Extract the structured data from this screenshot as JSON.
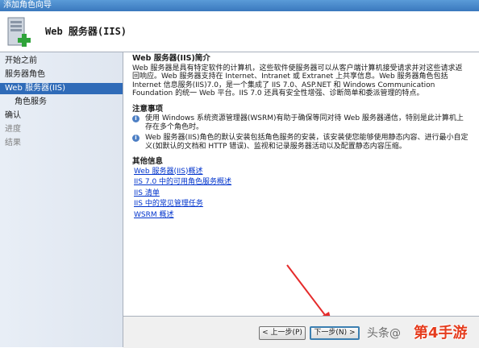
{
  "window": {
    "title": "添加角色向导"
  },
  "header": {
    "title": "Web 服务器(IIS)"
  },
  "nav": {
    "items": [
      {
        "label": "开始之前"
      },
      {
        "label": "服务器角色"
      },
      {
        "label": "Web 服务器(IIS)"
      },
      {
        "label": "角色服务"
      },
      {
        "label": "确认"
      },
      {
        "label": "进度"
      },
      {
        "label": "结果"
      }
    ]
  },
  "content": {
    "intro_title": "Web 服务器(IIS)简介",
    "intro_text": "Web 服务器是具有特定软件的计算机，这些软件使服务器可以从客户端计算机接受请求并对这些请求返回响应。Web 服务器支持在 Internet、Intranet 或 Extranet 上共享信息。Web 服务器角色包括 Internet 信息服务(IIS)7.0，是一个集成了 IIS 7.0、ASP.NET 和 Windows Communication Foundation 的统一 Web 平台。IIS 7.0 还具有安全性增强、诊断简单和委派管理的特点。",
    "notes_title": "注意事项",
    "note1": "使用 Windows 系统资源管理器(WSRM)有助于确保等同对待 Web 服务器通信，特别是此计算机上存在多个角色时。",
    "note2": "Web 服务器(IIS)角色的默认安装包括角色服务的安装，该安装使您能够使用静态内容、进行最小自定义(如默认的文档和 HTTP 错误)、监视和记录服务器活动以及配置静态内容压缩。",
    "more_title": "其他信息",
    "links": [
      {
        "label": "Web 服务器(IIS)概述"
      },
      {
        "label": "IIS 7.0 中的可用角色服务概述"
      },
      {
        "label": "IIS 清单"
      },
      {
        "label": "IIS 中的常见管理任务"
      },
      {
        "label": "WSRM 概述"
      }
    ]
  },
  "footer": {
    "prev_label": "< 上一步(P)",
    "next_label": "下一步(N) >",
    "watermark": "头条@",
    "brand": "第4手游"
  },
  "colors": {
    "accent": "#2f6bb8",
    "link": "#0033cc",
    "arrow": "#e52b2b"
  }
}
